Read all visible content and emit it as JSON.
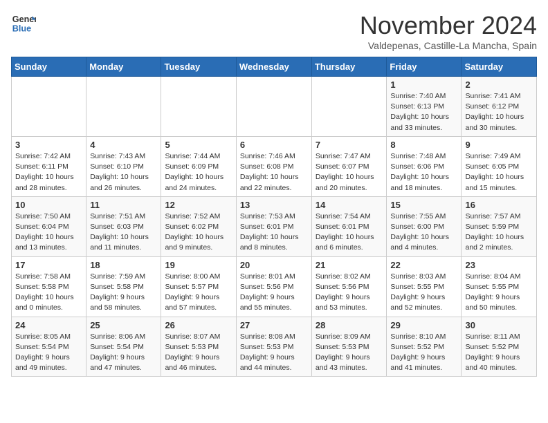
{
  "header": {
    "logo_line1": "General",
    "logo_line2": "Blue",
    "month": "November 2024",
    "location": "Valdepenas, Castille-La Mancha, Spain"
  },
  "weekdays": [
    "Sunday",
    "Monday",
    "Tuesday",
    "Wednesday",
    "Thursday",
    "Friday",
    "Saturday"
  ],
  "weeks": [
    [
      {
        "day": "",
        "info": ""
      },
      {
        "day": "",
        "info": ""
      },
      {
        "day": "",
        "info": ""
      },
      {
        "day": "",
        "info": ""
      },
      {
        "day": "",
        "info": ""
      },
      {
        "day": "1",
        "info": "Sunrise: 7:40 AM\nSunset: 6:13 PM\nDaylight: 10 hours\nand 33 minutes."
      },
      {
        "day": "2",
        "info": "Sunrise: 7:41 AM\nSunset: 6:12 PM\nDaylight: 10 hours\nand 30 minutes."
      }
    ],
    [
      {
        "day": "3",
        "info": "Sunrise: 7:42 AM\nSunset: 6:11 PM\nDaylight: 10 hours\nand 28 minutes."
      },
      {
        "day": "4",
        "info": "Sunrise: 7:43 AM\nSunset: 6:10 PM\nDaylight: 10 hours\nand 26 minutes."
      },
      {
        "day": "5",
        "info": "Sunrise: 7:44 AM\nSunset: 6:09 PM\nDaylight: 10 hours\nand 24 minutes."
      },
      {
        "day": "6",
        "info": "Sunrise: 7:46 AM\nSunset: 6:08 PM\nDaylight: 10 hours\nand 22 minutes."
      },
      {
        "day": "7",
        "info": "Sunrise: 7:47 AM\nSunset: 6:07 PM\nDaylight: 10 hours\nand 20 minutes."
      },
      {
        "day": "8",
        "info": "Sunrise: 7:48 AM\nSunset: 6:06 PM\nDaylight: 10 hours\nand 18 minutes."
      },
      {
        "day": "9",
        "info": "Sunrise: 7:49 AM\nSunset: 6:05 PM\nDaylight: 10 hours\nand 15 minutes."
      }
    ],
    [
      {
        "day": "10",
        "info": "Sunrise: 7:50 AM\nSunset: 6:04 PM\nDaylight: 10 hours\nand 13 minutes."
      },
      {
        "day": "11",
        "info": "Sunrise: 7:51 AM\nSunset: 6:03 PM\nDaylight: 10 hours\nand 11 minutes."
      },
      {
        "day": "12",
        "info": "Sunrise: 7:52 AM\nSunset: 6:02 PM\nDaylight: 10 hours\nand 9 minutes."
      },
      {
        "day": "13",
        "info": "Sunrise: 7:53 AM\nSunset: 6:01 PM\nDaylight: 10 hours\nand 8 minutes."
      },
      {
        "day": "14",
        "info": "Sunrise: 7:54 AM\nSunset: 6:01 PM\nDaylight: 10 hours\nand 6 minutes."
      },
      {
        "day": "15",
        "info": "Sunrise: 7:55 AM\nSunset: 6:00 PM\nDaylight: 10 hours\nand 4 minutes."
      },
      {
        "day": "16",
        "info": "Sunrise: 7:57 AM\nSunset: 5:59 PM\nDaylight: 10 hours\nand 2 minutes."
      }
    ],
    [
      {
        "day": "17",
        "info": "Sunrise: 7:58 AM\nSunset: 5:58 PM\nDaylight: 10 hours\nand 0 minutes."
      },
      {
        "day": "18",
        "info": "Sunrise: 7:59 AM\nSunset: 5:58 PM\nDaylight: 9 hours\nand 58 minutes."
      },
      {
        "day": "19",
        "info": "Sunrise: 8:00 AM\nSunset: 5:57 PM\nDaylight: 9 hours\nand 57 minutes."
      },
      {
        "day": "20",
        "info": "Sunrise: 8:01 AM\nSunset: 5:56 PM\nDaylight: 9 hours\nand 55 minutes."
      },
      {
        "day": "21",
        "info": "Sunrise: 8:02 AM\nSunset: 5:56 PM\nDaylight: 9 hours\nand 53 minutes."
      },
      {
        "day": "22",
        "info": "Sunrise: 8:03 AM\nSunset: 5:55 PM\nDaylight: 9 hours\nand 52 minutes."
      },
      {
        "day": "23",
        "info": "Sunrise: 8:04 AM\nSunset: 5:55 PM\nDaylight: 9 hours\nand 50 minutes."
      }
    ],
    [
      {
        "day": "24",
        "info": "Sunrise: 8:05 AM\nSunset: 5:54 PM\nDaylight: 9 hours\nand 49 minutes."
      },
      {
        "day": "25",
        "info": "Sunrise: 8:06 AM\nSunset: 5:54 PM\nDaylight: 9 hours\nand 47 minutes."
      },
      {
        "day": "26",
        "info": "Sunrise: 8:07 AM\nSunset: 5:53 PM\nDaylight: 9 hours\nand 46 minutes."
      },
      {
        "day": "27",
        "info": "Sunrise: 8:08 AM\nSunset: 5:53 PM\nDaylight: 9 hours\nand 44 minutes."
      },
      {
        "day": "28",
        "info": "Sunrise: 8:09 AM\nSunset: 5:53 PM\nDaylight: 9 hours\nand 43 minutes."
      },
      {
        "day": "29",
        "info": "Sunrise: 8:10 AM\nSunset: 5:52 PM\nDaylight: 9 hours\nand 41 minutes."
      },
      {
        "day": "30",
        "info": "Sunrise: 8:11 AM\nSunset: 5:52 PM\nDaylight: 9 hours\nand 40 minutes."
      }
    ]
  ]
}
